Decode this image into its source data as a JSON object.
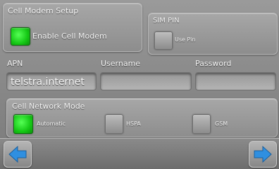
{
  "cell_modem": {
    "title": "Cell Modem Setup",
    "enable_label": "Enable Cell Modem",
    "enable_checked": true
  },
  "sim_pin": {
    "title": "SIM PIN",
    "use_pin_label": "Use Pin",
    "use_pin_checked": false
  },
  "apn": {
    "label": "APN",
    "value": "telstra.internet"
  },
  "username": {
    "label": "Username",
    "value": ""
  },
  "password": {
    "label": "Password",
    "value": ""
  },
  "network_mode": {
    "title": "Cell Network Mode",
    "options": [
      {
        "label": "Automatic",
        "checked": true
      },
      {
        "label": "HSPA",
        "checked": false
      },
      {
        "label": "GSM",
        "checked": false
      }
    ]
  },
  "nav": {
    "back_icon": "arrow-left-icon",
    "next_icon": "arrow-right-icon",
    "arrow_color": "#2f8fe0"
  },
  "colors": {
    "checked_green": "#15c815"
  }
}
